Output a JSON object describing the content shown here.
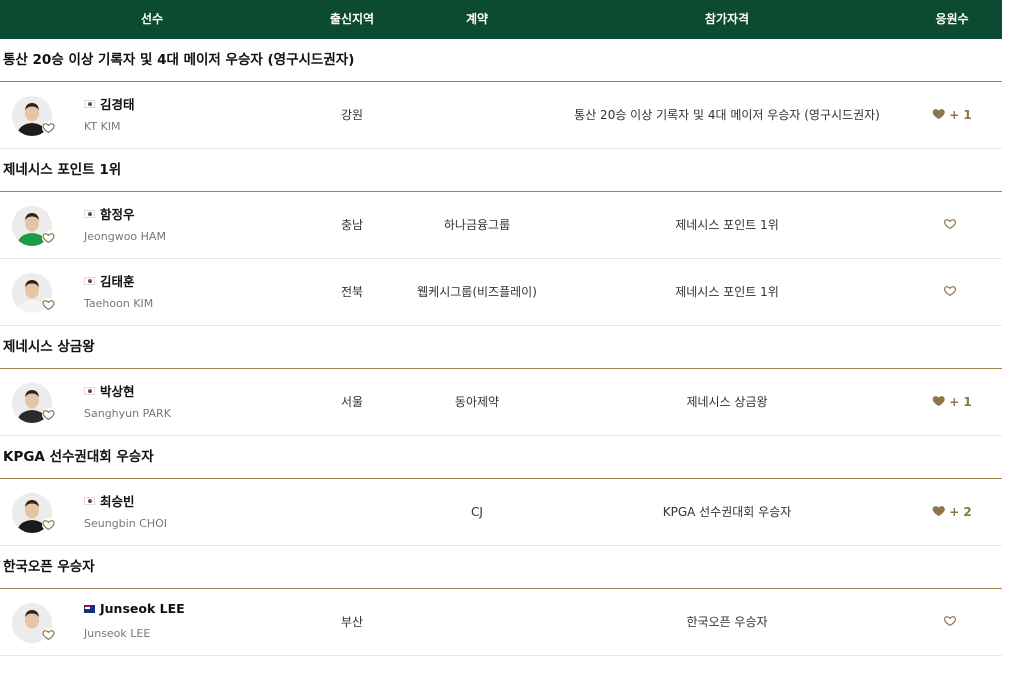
{
  "colors": {
    "header_bg": "#0c4a32",
    "accent_gold": "#8e7648",
    "group_border": "#9b8250"
  },
  "headers": {
    "player": "선수",
    "region": "출신지역",
    "contract": "계약",
    "qualification": "참가자격",
    "cheers": "응원수"
  },
  "groups": [
    {
      "title": "통산 20승 이상 기록자 및 4대 메이저 우승자 (영구시드권자)",
      "players": [
        {
          "name_ko": "김경태",
          "name_en": "KT KIM",
          "flag": "kr",
          "region": "강원",
          "contract": "",
          "qualification": "통산 20승 이상 기록자 및 4대 메이저 우승자 (영구시드권자)",
          "cheer_icon": "heart-filled-icon",
          "cheer_count": "+ 1",
          "shirt": "#1c1c1c"
        }
      ]
    },
    {
      "title": "제네시스 포인트 1위",
      "players": [
        {
          "name_ko": "함정우",
          "name_en": "Jeongwoo HAM",
          "flag": "kr",
          "region": "충남",
          "contract": "하나금융그룹",
          "qualification": "제네시스 포인트 1위",
          "cheer_icon": "heart-outline-icon",
          "cheer_count": "",
          "shirt": "#1d9a4a"
        },
        {
          "name_ko": "김태훈",
          "name_en": "Taehoon KIM",
          "flag": "kr",
          "region": "전북",
          "contract": "웹케시그룹(비즈플레이)",
          "qualification": "제네시스 포인트 1위",
          "cheer_icon": "heart-outline-icon",
          "cheer_count": "",
          "shirt": "#f4f4f4"
        }
      ]
    },
    {
      "title": "제네시스 상금왕",
      "players": [
        {
          "name_ko": "박상현",
          "name_en": "Sanghyun PARK",
          "flag": "kr",
          "region": "서울",
          "contract": "동아제약",
          "qualification": "제네시스 상금왕",
          "cheer_icon": "heart-filled-icon",
          "cheer_count": "+ 1",
          "shirt": "#2a2a2a"
        }
      ]
    },
    {
      "title": "KPGA 선수권대회 우승자",
      "players": [
        {
          "name_ko": "최승빈",
          "name_en": "Seungbin CHOI",
          "flag": "kr",
          "region": "",
          "contract": "CJ",
          "qualification": "KPGA 선수권대회 우승자",
          "cheer_icon": "heart-filled-icon",
          "cheer_count": "+ 2",
          "shirt": "#1a1a1a"
        }
      ]
    },
    {
      "title": "한국오픈 우승자",
      "players": [
        {
          "name_ko": "Junseok LEE",
          "name_en": "Junseok LEE",
          "flag": "au",
          "region": "부산",
          "contract": "",
          "qualification": "한국오픈 우승자",
          "cheer_icon": "heart-outline-icon",
          "cheer_count": "",
          "shirt": "#ececec"
        }
      ]
    }
  ]
}
